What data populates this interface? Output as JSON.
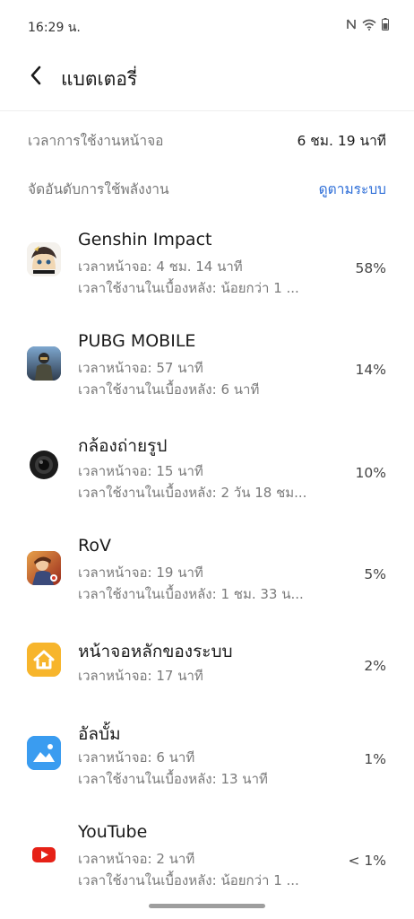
{
  "status_bar": {
    "time": "16:29 น.",
    "icons": [
      "nfc-icon",
      "wifi-icon",
      "battery-icon"
    ]
  },
  "header": {
    "title": "แบตเตอรี่",
    "back_icon": "back-arrow-icon"
  },
  "screen_time": {
    "label": "เวลาการใช้งานหน้าจอ",
    "value": "6 ชม. 19 นาที"
  },
  "sort": {
    "label": "จัดอันดับการใช้พลังงาน",
    "link": "ดูตามระบบ"
  },
  "apps": [
    {
      "name": "Genshin Impact",
      "icon": "genshin-impact-icon",
      "line1": "เวลาหน้าจอ: 4 ชม. 14 นาที",
      "line2": "เวลาใช้งานในเบื้องหลัง: น้อยกว่า 1 ...",
      "percent": "58%"
    },
    {
      "name": "PUBG MOBILE",
      "icon": "pubg-mobile-icon",
      "line1": "เวลาหน้าจอ: 57 นาที",
      "line2": "เวลาใช้งานในเบื้องหลัง: 6 นาที",
      "percent": "14%"
    },
    {
      "name": "กล้องถ่ายรูป",
      "icon": "camera-icon",
      "line1": "เวลาหน้าจอ: 15 นาที",
      "line2": "เวลาใช้งานในเบื้องหลัง: 2 วัน 18 ชม...",
      "percent": "10%"
    },
    {
      "name": "RoV",
      "icon": "rov-icon",
      "line1": "เวลาหน้าจอ: 19 นาที",
      "line2": "เวลาใช้งานในเบื้องหลัง: 1 ชม. 33 น...",
      "percent": "5%"
    },
    {
      "name": "หน้าจอหลักของระบบ",
      "icon": "home-icon",
      "line1": "เวลาหน้าจอ: 17 นาที",
      "line2": "",
      "percent": "2%"
    },
    {
      "name": "อัลบั้ม",
      "icon": "album-icon",
      "line1": "เวลาหน้าจอ: 6 นาที",
      "line2": "เวลาใช้งานในเบื้องหลัง: 13 นาที",
      "percent": "1%"
    },
    {
      "name": "YouTube",
      "icon": "youtube-icon",
      "line1": "เวลาหน้าจอ: 2 นาที",
      "line2": "เวลาใช้งานในเบื้องหลัง: น้อยกว่า 1 ...",
      "percent": "< 1%"
    }
  ],
  "colors": {
    "accent": "#2f6fd8",
    "secondary_text": "#7a7a7a",
    "home_icon_bg": "#f7b52c",
    "album_icon_bg": "#3a9cf0",
    "youtube_red": "#e62117"
  }
}
